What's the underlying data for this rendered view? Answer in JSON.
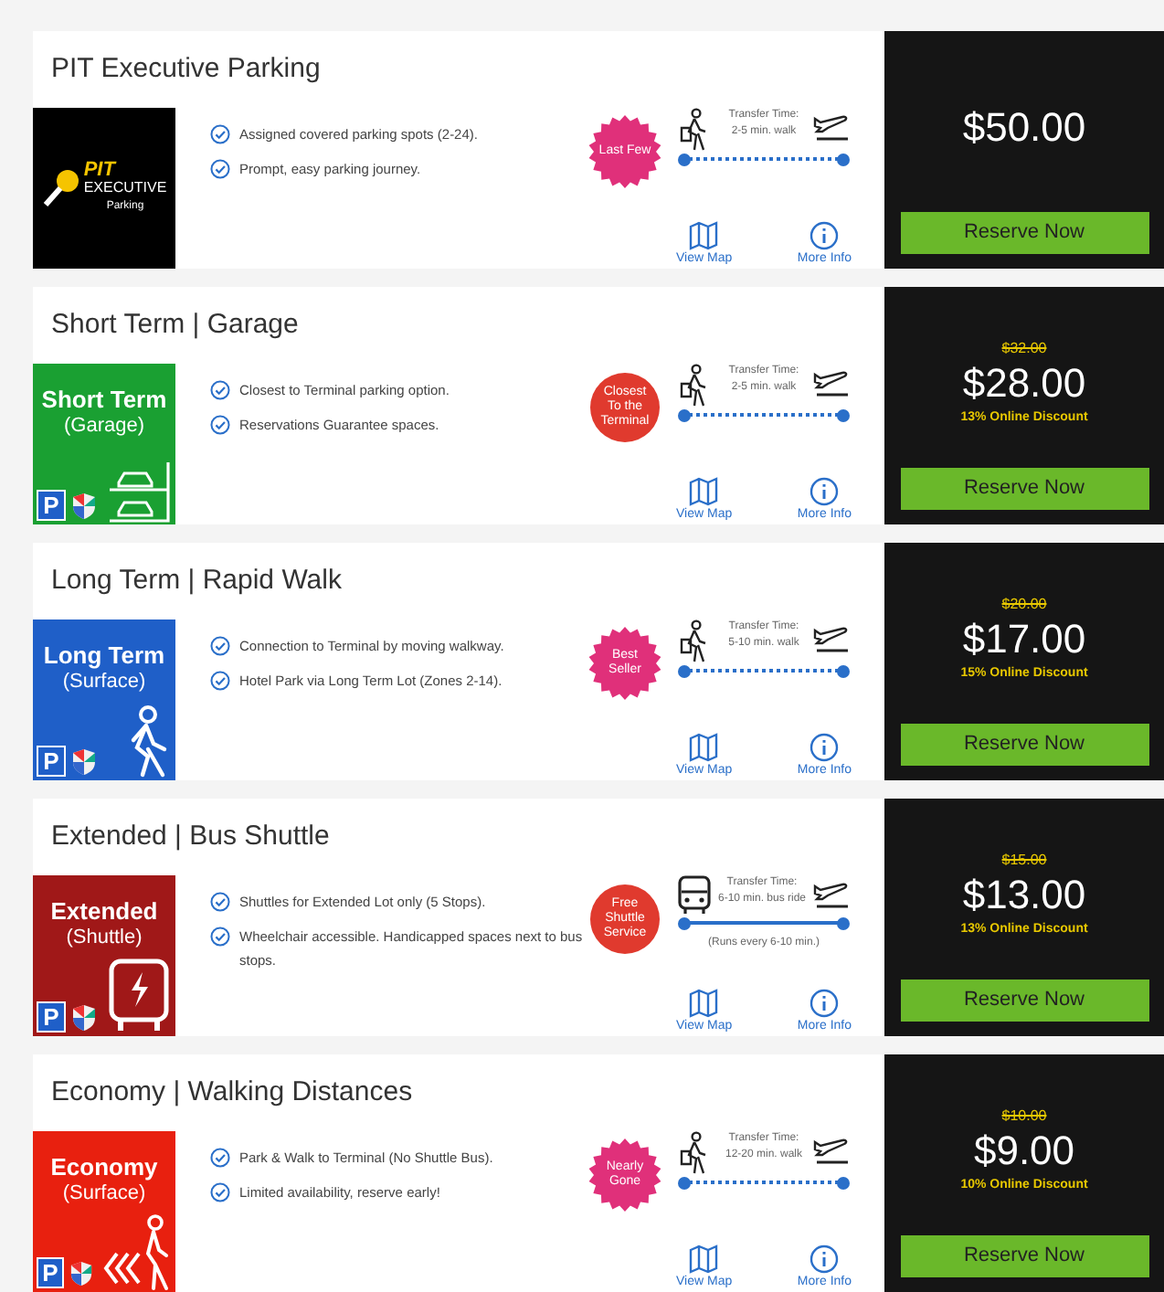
{
  "lots": [
    {
      "title": "PIT Executive Parking",
      "logo": {
        "kind": "exec",
        "brand": "PIT",
        "line1": "EXECUTIVE",
        "line2": "Parking"
      },
      "features": [
        "Assigned covered parking spots (2-24).",
        "Prompt, easy parking journey."
      ],
      "badge": {
        "kind": "starburst",
        "text": "Last Few",
        "color": "#e0307a"
      },
      "transfer": {
        "kind": "walk",
        "label": "Transfer Time:",
        "time": "2-5 min. walk"
      },
      "links": [
        "View Map",
        "More Info"
      ],
      "price": {
        "amount": "$50.00"
      },
      "button": "Reserve Now"
    },
    {
      "title": "Short Term | Garage",
      "logo": {
        "kind": "garage",
        "color": "#1aa032",
        "line1": "Short Term",
        "line2": "(Garage)",
        "sign": "P"
      },
      "features": [
        "Closest to Terminal parking option.",
        "Reservations Guarantee spaces."
      ],
      "badge": {
        "kind": "circle",
        "text": "Closest To the Terminal",
        "color": "#e03a2e"
      },
      "transfer": {
        "kind": "walk",
        "label": "Transfer Time:",
        "time": "2-5 min. walk"
      },
      "links": [
        "View Map",
        "More Info"
      ],
      "price": {
        "old": "$32.00",
        "amount": "$28.00",
        "discount": "13% Online Discount"
      },
      "button": "Reserve Now"
    },
    {
      "title": "Long Term | Rapid Walk",
      "logo": {
        "kind": "walk",
        "color": "#1f5fc8",
        "line1": "Long Term",
        "line2": "(Surface)",
        "sign": "P"
      },
      "features": [
        "Connection to Terminal by moving walkway.",
        "Hotel Park via Long Term Lot (Zones 2-14)."
      ],
      "badge": {
        "kind": "starburst",
        "text": "Best Seller",
        "color": "#e0307a"
      },
      "transfer": {
        "kind": "walk",
        "label": "Transfer Time:",
        "time": "5-10 min. walk"
      },
      "links": [
        "View Map",
        "More Info"
      ],
      "price": {
        "old": "$20.00",
        "amount": "$17.00",
        "discount": "15% Online Discount"
      },
      "button": "Reserve Now"
    },
    {
      "title": "Extended | Bus Shuttle",
      "logo": {
        "kind": "bus",
        "color": "#a01818",
        "line1": "Extended",
        "line2": "(Shuttle)",
        "sign": "P"
      },
      "features": [
        "Shuttles for Extended Lot only (5 Stops).",
        "Wheelchair accessible. Handicapped spaces next to bus stops."
      ],
      "badge": {
        "kind": "circle",
        "text": "Free Shuttle Service",
        "color": "#e03a2e"
      },
      "transfer": {
        "kind": "bus",
        "label": "Transfer Time:",
        "time": "6-10 min. bus ride",
        "note": "(Runs every 6-10 min.)"
      },
      "links": [
        "View Map",
        "More Info"
      ],
      "price": {
        "old": "$15.00",
        "amount": "$13.00",
        "discount": "13% Online Discount"
      },
      "button": "Reserve Now"
    },
    {
      "title": "Economy | Walking Distances",
      "logo": {
        "kind": "walk-arrows",
        "color": "#e8200f",
        "line1": "Economy",
        "line2": "(Surface)",
        "sign": "P"
      },
      "features": [
        "Park & Walk to Terminal (No Shuttle Bus).",
        "Limited availability, reserve early!"
      ],
      "badge": {
        "kind": "starburst",
        "text": "Nearly Gone",
        "color": "#e0307a"
      },
      "transfer": {
        "kind": "walk",
        "label": "Transfer Time:",
        "time": "12-20 min. walk"
      },
      "links": [
        "View Map",
        "More Info"
      ],
      "price": {
        "old": "$10.00",
        "amount": "$9.00",
        "discount": "10% Online Discount"
      },
      "button": "Reserve Now"
    }
  ]
}
